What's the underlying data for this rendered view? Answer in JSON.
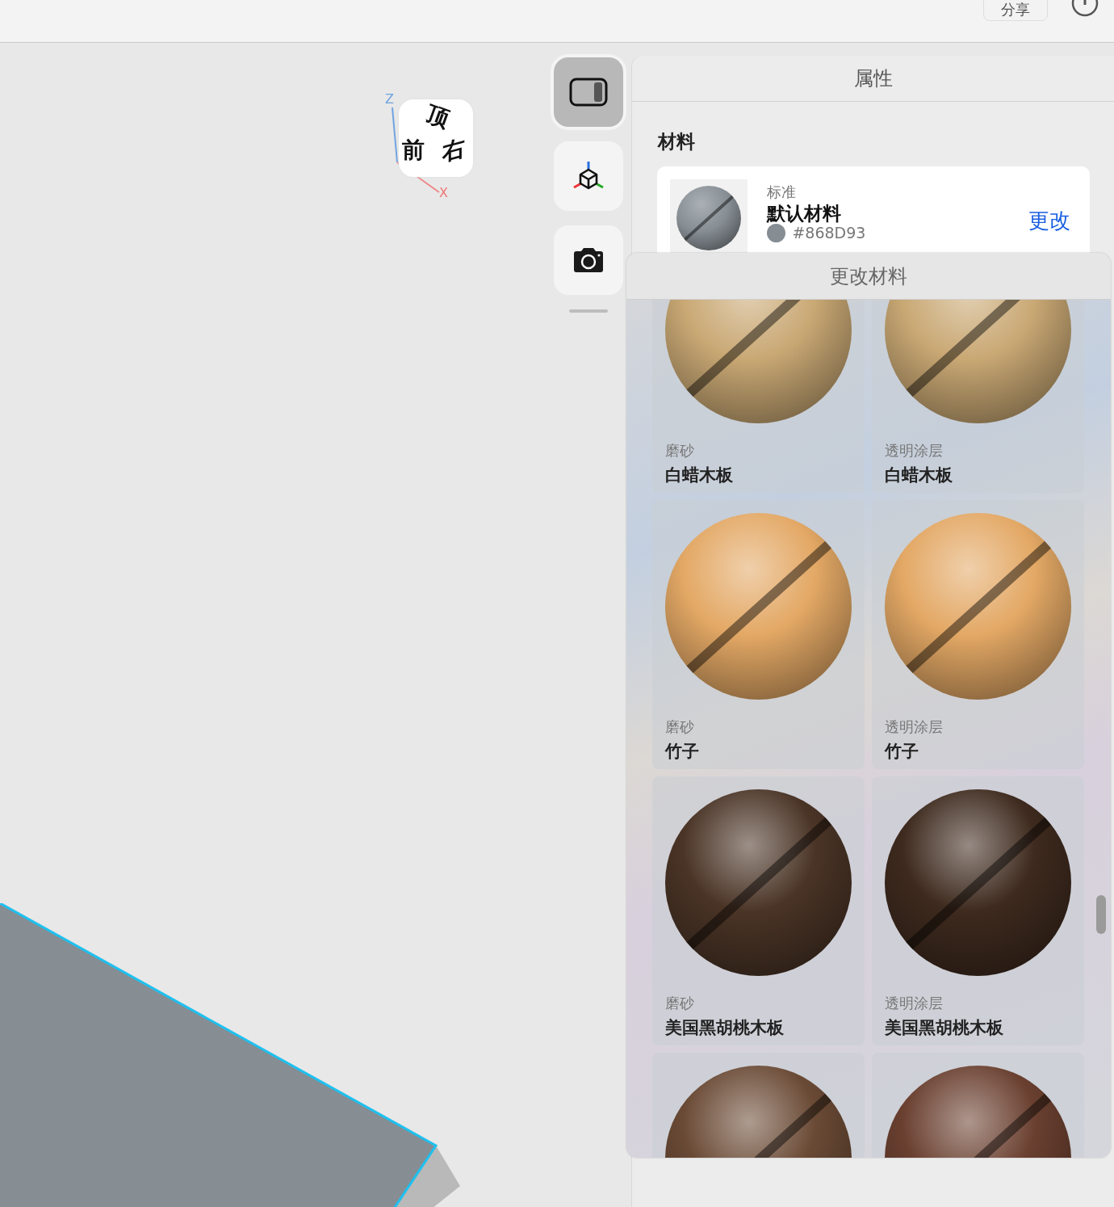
{
  "top_bar": {
    "share_button": "分享"
  },
  "view_cube": {
    "faces": [
      "顶",
      "前",
      "右"
    ],
    "axes": [
      "Z",
      "X"
    ]
  },
  "toolbar": [
    {
      "kind": "panel",
      "selected": true
    },
    {
      "kind": "axes",
      "selected": false
    },
    {
      "kind": "camera",
      "selected": false
    }
  ],
  "properties_panel": {
    "title": "属性",
    "section": "材料",
    "current_material": {
      "type": "标准",
      "name": "默认材料",
      "color": "#868D93",
      "hex": "#868D93",
      "change_link": "更改"
    }
  },
  "change_material_popover": {
    "title": "更改材料",
    "materials": [
      {
        "finish": "磨砂",
        "name": "白蜡木板",
        "color": "#c9a874"
      },
      {
        "finish": "透明涂层",
        "name": "白蜡木板",
        "color": "#c9a874"
      },
      {
        "finish": "磨砂",
        "name": "竹子",
        "color": "#e3a865"
      },
      {
        "finish": "透明涂层",
        "name": "竹子",
        "color": "#e3a865"
      },
      {
        "finish": "磨砂",
        "name": "美国黑胡桃木板",
        "color": "#4a3426"
      },
      {
        "finish": "透明涂层",
        "name": "美国黑胡桃木板",
        "color": "#3e2a1e"
      },
      {
        "color": "#6a4a35"
      },
      {
        "color": "#6a4030"
      }
    ]
  }
}
